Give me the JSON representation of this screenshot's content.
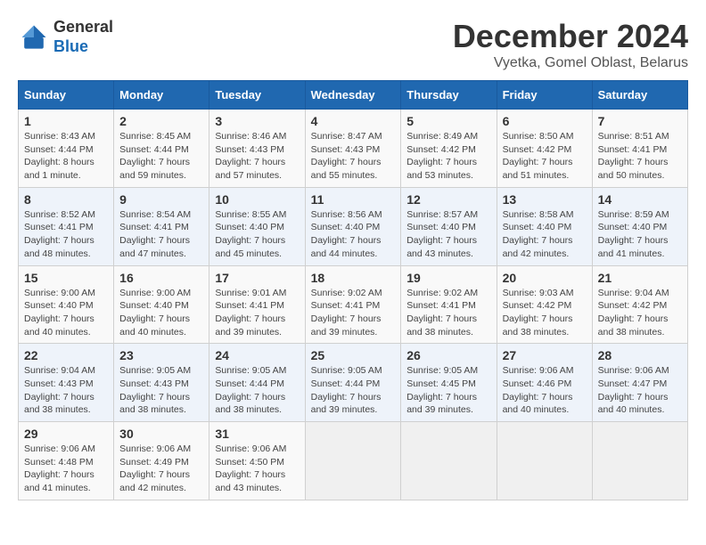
{
  "header": {
    "logo_line1": "General",
    "logo_line2": "Blue",
    "month": "December 2024",
    "location": "Vyetka, Gomel Oblast, Belarus"
  },
  "weekdays": [
    "Sunday",
    "Monday",
    "Tuesday",
    "Wednesday",
    "Thursday",
    "Friday",
    "Saturday"
  ],
  "weeks": [
    [
      {
        "day": "1",
        "info": "Sunrise: 8:43 AM\nSunset: 4:44 PM\nDaylight: 8 hours\nand 1 minute."
      },
      {
        "day": "2",
        "info": "Sunrise: 8:45 AM\nSunset: 4:44 PM\nDaylight: 7 hours\nand 59 minutes."
      },
      {
        "day": "3",
        "info": "Sunrise: 8:46 AM\nSunset: 4:43 PM\nDaylight: 7 hours\nand 57 minutes."
      },
      {
        "day": "4",
        "info": "Sunrise: 8:47 AM\nSunset: 4:43 PM\nDaylight: 7 hours\nand 55 minutes."
      },
      {
        "day": "5",
        "info": "Sunrise: 8:49 AM\nSunset: 4:42 PM\nDaylight: 7 hours\nand 53 minutes."
      },
      {
        "day": "6",
        "info": "Sunrise: 8:50 AM\nSunset: 4:42 PM\nDaylight: 7 hours\nand 51 minutes."
      },
      {
        "day": "7",
        "info": "Sunrise: 8:51 AM\nSunset: 4:41 PM\nDaylight: 7 hours\nand 50 minutes."
      }
    ],
    [
      {
        "day": "8",
        "info": "Sunrise: 8:52 AM\nSunset: 4:41 PM\nDaylight: 7 hours\nand 48 minutes."
      },
      {
        "day": "9",
        "info": "Sunrise: 8:54 AM\nSunset: 4:41 PM\nDaylight: 7 hours\nand 47 minutes."
      },
      {
        "day": "10",
        "info": "Sunrise: 8:55 AM\nSunset: 4:40 PM\nDaylight: 7 hours\nand 45 minutes."
      },
      {
        "day": "11",
        "info": "Sunrise: 8:56 AM\nSunset: 4:40 PM\nDaylight: 7 hours\nand 44 minutes."
      },
      {
        "day": "12",
        "info": "Sunrise: 8:57 AM\nSunset: 4:40 PM\nDaylight: 7 hours\nand 43 minutes."
      },
      {
        "day": "13",
        "info": "Sunrise: 8:58 AM\nSunset: 4:40 PM\nDaylight: 7 hours\nand 42 minutes."
      },
      {
        "day": "14",
        "info": "Sunrise: 8:59 AM\nSunset: 4:40 PM\nDaylight: 7 hours\nand 41 minutes."
      }
    ],
    [
      {
        "day": "15",
        "info": "Sunrise: 9:00 AM\nSunset: 4:40 PM\nDaylight: 7 hours\nand 40 minutes."
      },
      {
        "day": "16",
        "info": "Sunrise: 9:00 AM\nSunset: 4:40 PM\nDaylight: 7 hours\nand 40 minutes."
      },
      {
        "day": "17",
        "info": "Sunrise: 9:01 AM\nSunset: 4:41 PM\nDaylight: 7 hours\nand 39 minutes."
      },
      {
        "day": "18",
        "info": "Sunrise: 9:02 AM\nSunset: 4:41 PM\nDaylight: 7 hours\nand 39 minutes."
      },
      {
        "day": "19",
        "info": "Sunrise: 9:02 AM\nSunset: 4:41 PM\nDaylight: 7 hours\nand 38 minutes."
      },
      {
        "day": "20",
        "info": "Sunrise: 9:03 AM\nSunset: 4:42 PM\nDaylight: 7 hours\nand 38 minutes."
      },
      {
        "day": "21",
        "info": "Sunrise: 9:04 AM\nSunset: 4:42 PM\nDaylight: 7 hours\nand 38 minutes."
      }
    ],
    [
      {
        "day": "22",
        "info": "Sunrise: 9:04 AM\nSunset: 4:43 PM\nDaylight: 7 hours\nand 38 minutes."
      },
      {
        "day": "23",
        "info": "Sunrise: 9:05 AM\nSunset: 4:43 PM\nDaylight: 7 hours\nand 38 minutes."
      },
      {
        "day": "24",
        "info": "Sunrise: 9:05 AM\nSunset: 4:44 PM\nDaylight: 7 hours\nand 38 minutes."
      },
      {
        "day": "25",
        "info": "Sunrise: 9:05 AM\nSunset: 4:44 PM\nDaylight: 7 hours\nand 39 minutes."
      },
      {
        "day": "26",
        "info": "Sunrise: 9:05 AM\nSunset: 4:45 PM\nDaylight: 7 hours\nand 39 minutes."
      },
      {
        "day": "27",
        "info": "Sunrise: 9:06 AM\nSunset: 4:46 PM\nDaylight: 7 hours\nand 40 minutes."
      },
      {
        "day": "28",
        "info": "Sunrise: 9:06 AM\nSunset: 4:47 PM\nDaylight: 7 hours\nand 40 minutes."
      }
    ],
    [
      {
        "day": "29",
        "info": "Sunrise: 9:06 AM\nSunset: 4:48 PM\nDaylight: 7 hours\nand 41 minutes."
      },
      {
        "day": "30",
        "info": "Sunrise: 9:06 AM\nSunset: 4:49 PM\nDaylight: 7 hours\nand 42 minutes."
      },
      {
        "day": "31",
        "info": "Sunrise: 9:06 AM\nSunset: 4:50 PM\nDaylight: 7 hours\nand 43 minutes."
      },
      null,
      null,
      null,
      null
    ]
  ]
}
